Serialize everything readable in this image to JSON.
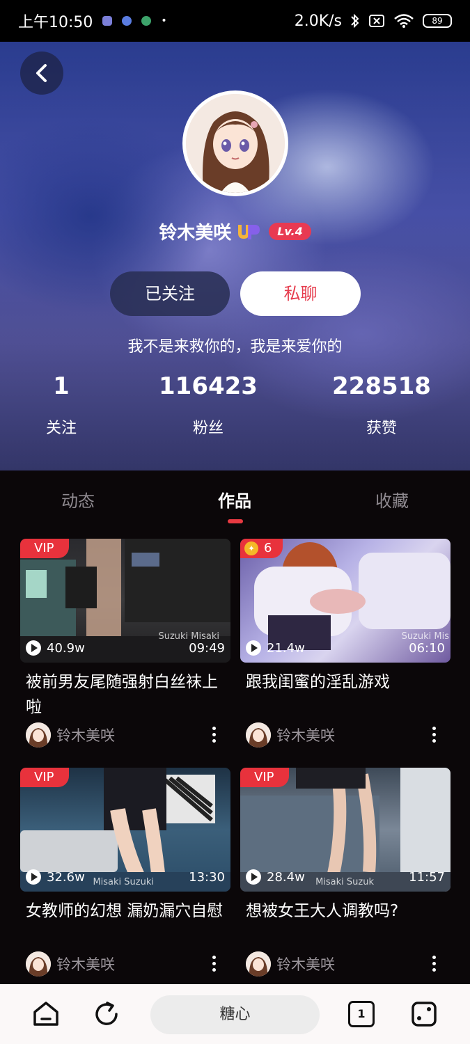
{
  "status_bar": {
    "time": "上午10:50",
    "network_speed": "2.0K/s",
    "battery": "89"
  },
  "profile": {
    "name": "铃木美咲",
    "level": "Lv.4",
    "follow_button": "已关注",
    "message_button": "私聊",
    "bio": "我不是来救你的，我是来爱你的",
    "stats": [
      {
        "value": "1",
        "label": "关注"
      },
      {
        "value": "116423",
        "label": "粉丝"
      },
      {
        "value": "228518",
        "label": "获赞"
      }
    ]
  },
  "tabs": [
    {
      "label": "动态",
      "active": false
    },
    {
      "label": "作品",
      "active": true
    },
    {
      "label": "收藏",
      "active": false
    }
  ],
  "videos": [
    {
      "badge": "VIP",
      "views": "40.9w",
      "duration": "09:49",
      "watermark": "Suzuki Misaki",
      "title": "被前男友尾随强射白丝袜上啦",
      "author": "铃木美咲"
    },
    {
      "badge": "6",
      "views": "21.4w",
      "duration": "06:10",
      "watermark": "Suzuki Mis",
      "title": "跟我闺蜜的淫乱游戏",
      "author": "铃木美咲"
    },
    {
      "badge": "VIP",
      "views": "32.6w",
      "duration": "13:30",
      "watermark": "Misaki Suzuki",
      "title": "女教师的幻想 漏奶漏穴自慰",
      "author": "铃木美咲"
    },
    {
      "badge": "VIP",
      "views": "28.4w",
      "duration": "11:57",
      "watermark": "Misaki Suzuk",
      "title": "想被女王大人调教吗?",
      "author": "铃木美咲"
    }
  ],
  "bottom_nav": {
    "search_label": "糖心",
    "tab_count": "1"
  },
  "colors": {
    "accent": "#e83a42",
    "background": "#0b0709"
  }
}
